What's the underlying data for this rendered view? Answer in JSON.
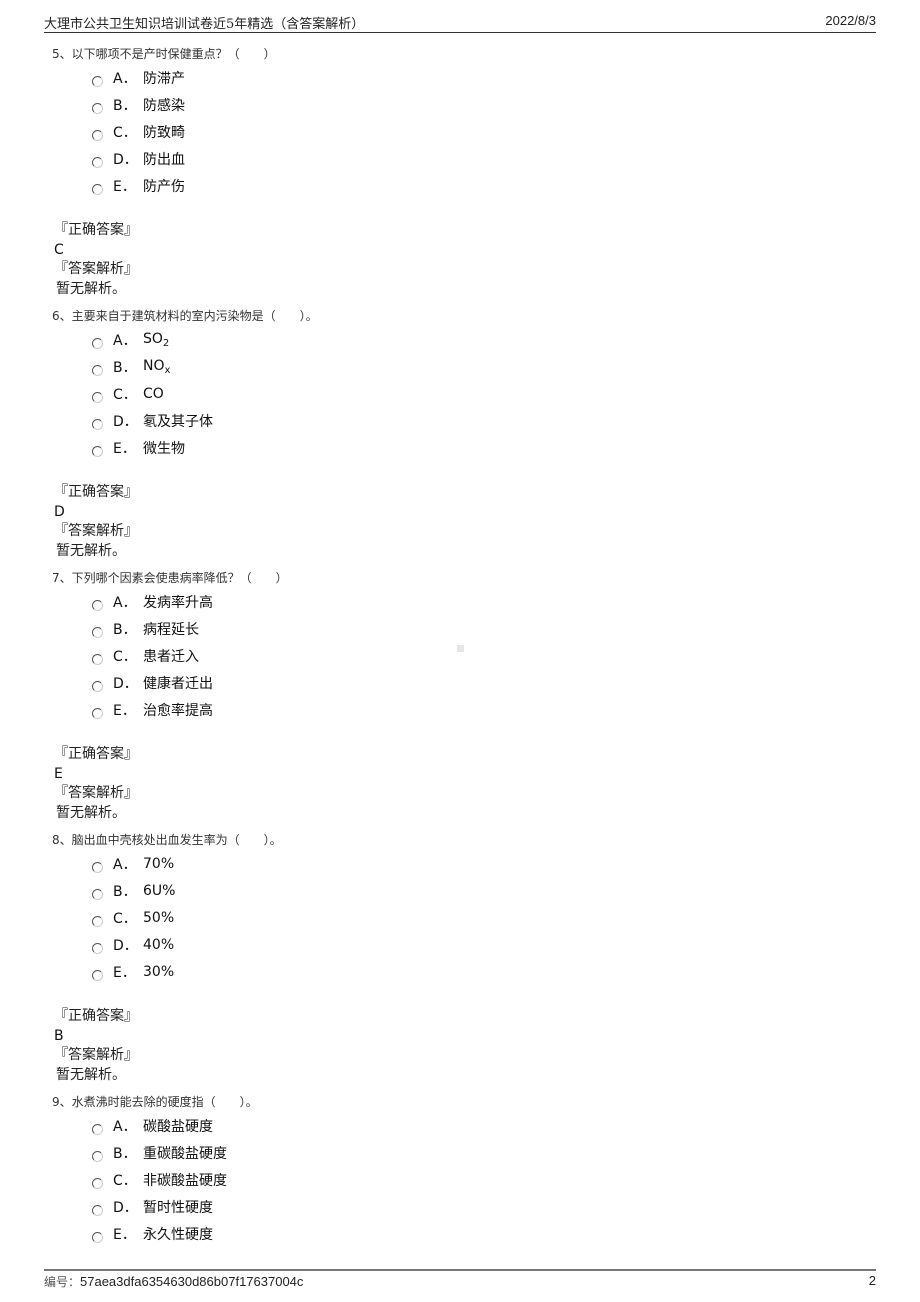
{
  "header": {
    "title": "大理市公共卫生知识培训试卷近5年精选（含答案解析）",
    "date": "2022/8/3"
  },
  "labels": {
    "correct_answer": "『正确答案』",
    "analysis": "『答案解析』"
  },
  "questions": [
    {
      "number": "5、",
      "stem": "以下哪项不是产时保健重点？（　　）",
      "options": [
        {
          "letter": "A．",
          "text": "防滞产"
        },
        {
          "letter": "B．",
          "text": "防感染"
        },
        {
          "letter": "C．",
          "text": "防致畸"
        },
        {
          "letter": "D．",
          "text": "防出血"
        },
        {
          "letter": "E．",
          "text": "防产伤"
        }
      ],
      "answer": "C",
      "analysis": "暂无解析。"
    },
    {
      "number": "6、",
      "stem": "主要来自于建筑材料的室内污染物是（　　）。",
      "options": [
        {
          "letter": "A．",
          "text": "SO",
          "sub": "2"
        },
        {
          "letter": "B．",
          "text": "NO",
          "sub": "x"
        },
        {
          "letter": "C．",
          "text": "CO"
        },
        {
          "letter": "D．",
          "text": "氡及其子体"
        },
        {
          "letter": "E．",
          "text": "微生物"
        }
      ],
      "answer": "D",
      "analysis": "暂无解析。"
    },
    {
      "number": "7、",
      "stem": "下列哪个因素会使患病率降低？（　　）",
      "options": [
        {
          "letter": "A．",
          "text": "发病率升高"
        },
        {
          "letter": "B．",
          "text": "病程延长"
        },
        {
          "letter": "C．",
          "text": "患者迁入"
        },
        {
          "letter": "D．",
          "text": "健康者迁出"
        },
        {
          "letter": "E．",
          "text": "治愈率提高"
        }
      ],
      "answer": "E",
      "analysis": "暂无解析。"
    },
    {
      "number": "8、",
      "stem": "脑出血中壳核处出血发生率为（　　）。",
      "options": [
        {
          "letter": "A．",
          "text": "70%"
        },
        {
          "letter": "B．",
          "text": "6U%"
        },
        {
          "letter": "C．",
          "text": "50%"
        },
        {
          "letter": "D．",
          "text": "40%"
        },
        {
          "letter": "E．",
          "text": "30%"
        }
      ],
      "answer": "B",
      "analysis": "暂无解析。"
    },
    {
      "number": "9、",
      "stem": "水煮沸时能去除的硬度指（　　）。",
      "options": [
        {
          "letter": "A．",
          "text": "碳酸盐硬度"
        },
        {
          "letter": "B．",
          "text": "重碳酸盐硬度"
        },
        {
          "letter": "C．",
          "text": "非碳酸盐硬度"
        },
        {
          "letter": "D．",
          "text": "暂时性硬度"
        },
        {
          "letter": "E．",
          "text": "永久性硬度"
        }
      ]
    }
  ],
  "footer": {
    "code_label": "编号：",
    "code": "57aea3dfa6354630d86b07f17637004c",
    "page": "2"
  }
}
